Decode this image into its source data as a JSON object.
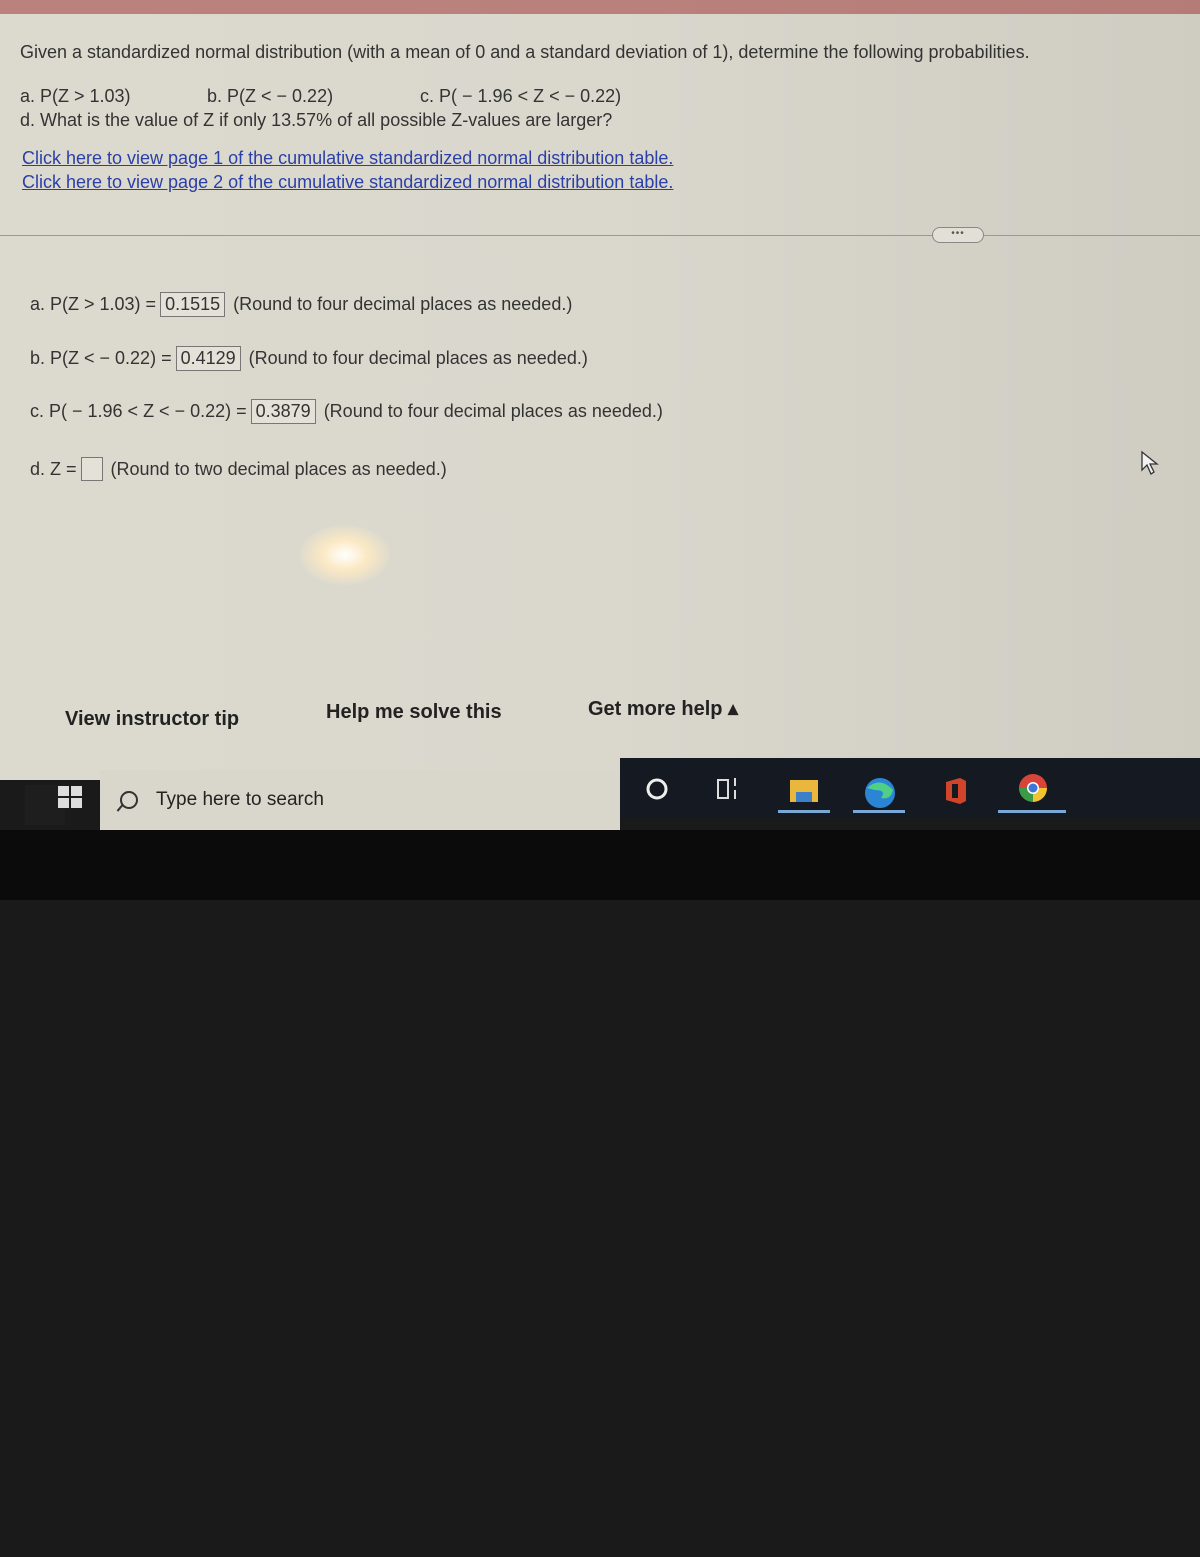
{
  "question": {
    "title": "Given a standardized normal distribution (with a mean of 0 and a standard deviation of 1), determine the following probabilities.",
    "part_a": "a. P(Z > 1.03)",
    "part_b": "b. P(Z < − 0.22)",
    "part_c": "c. P( − 1.96 < Z < − 0.22)",
    "part_d": "d. What is the value of Z if only 13.57% of all possible Z-values are larger?",
    "link_1": "Click here to view page 1 of the cumulative standardized normal distribution table.",
    "link_2": "Click here to view page 2 of the cumulative standardized normal distribution table.",
    "more_label": "•••"
  },
  "answers": [
    {
      "label": "a. P(Z > 1.03) =",
      "value": "0.1515",
      "hint": "(Round to four decimal places as needed.)"
    },
    {
      "label": "b. P(Z < − 0.22) =",
      "value": "0.4129",
      "hint": "(Round to four decimal places as needed.)"
    },
    {
      "label": "c. P( − 1.96 < Z < − 0.22) =",
      "value": "0.3879",
      "hint": "(Round to four decimal places as needed.)"
    },
    {
      "label": "d. Z =",
      "value": "",
      "hint": "(Round to two decimal places as needed.)"
    }
  ],
  "footer": {
    "instructor_tip": "View instructor tip",
    "help_solve": "Help me solve this",
    "more_help": "Get more help ▴"
  },
  "taskbar": {
    "search_placeholder": "Type here to search",
    "icons": [
      "cortana-icon",
      "task-view-icon",
      "file-explorer-icon",
      "edge-icon",
      "office-icon",
      "chrome-icon"
    ]
  }
}
